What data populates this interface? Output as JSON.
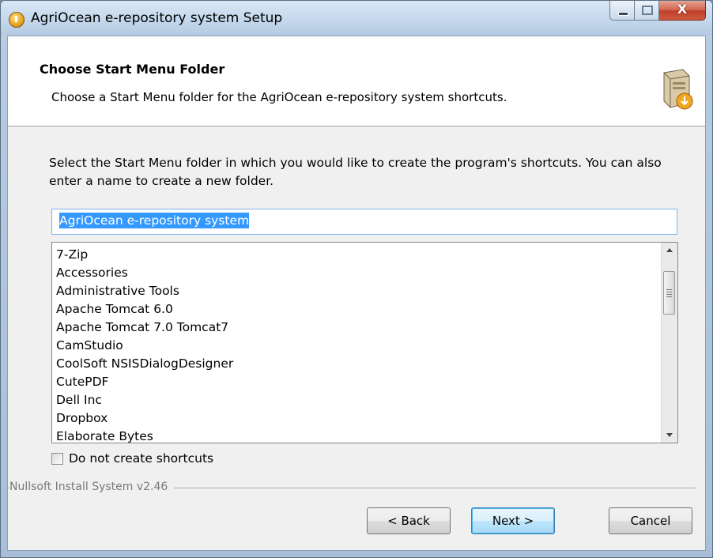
{
  "window": {
    "title": "AgriOcean e-repository system Setup",
    "controls": {
      "close_glyph": "X"
    }
  },
  "header": {
    "title": "Choose Start Menu Folder",
    "subtitle": "Choose a Start Menu folder for the AgriOcean e-repository system shortcuts.",
    "icon": "installer-box-icon"
  },
  "instruction": "Select the Start Menu folder in which you would like to create the program's shortcuts. You can also enter a name to create a new folder.",
  "folder_input": {
    "value": "AgriOcean e-repository system"
  },
  "folders": [
    "7-Zip",
    "Accessories",
    "Administrative Tools",
    "Apache Tomcat 6.0",
    "Apache Tomcat 7.0 Tomcat7",
    "CamStudio",
    "CoolSoft NSISDialogDesigner",
    "CutePDF",
    "Dell Inc",
    "Dropbox",
    "Elaborate Bytes"
  ],
  "checkbox": {
    "label": "Do not create shortcuts",
    "checked": false
  },
  "branding": "Nullsoft Install System v2.46",
  "buttons": {
    "back": "< Back",
    "next": "Next >",
    "cancel": "Cancel"
  },
  "colors": {
    "selection": "#3399ff",
    "close_button": "#c0402a",
    "default_button_border": "#3c7fb1"
  }
}
